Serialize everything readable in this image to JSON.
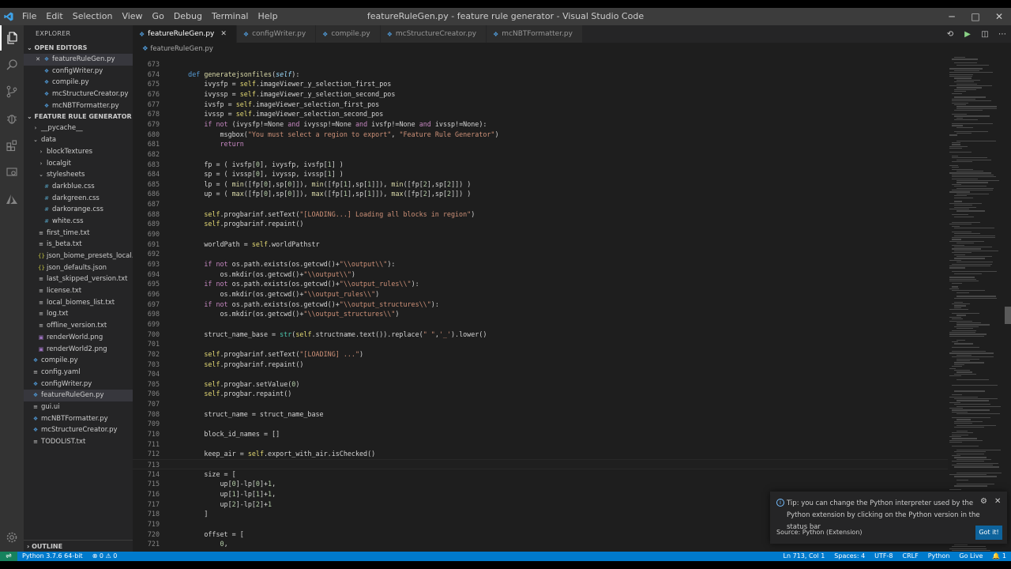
{
  "window": {
    "title": "featureRuleGen.py - feature rule generator - Visual Studio Code",
    "menu": [
      "File",
      "Edit",
      "Selection",
      "View",
      "Go",
      "Debug",
      "Terminal",
      "Help"
    ],
    "controls": {
      "minimize": "─",
      "maximize": "□",
      "close": "✕"
    }
  },
  "colors": {
    "accent": "#007acc",
    "sidebar_bg": "#252526",
    "editor_bg": "#1e1e1e",
    "python_icon": "#4e94ce"
  },
  "activity_bar": [
    "files-icon",
    "search-icon",
    "source-control-icon",
    "debug-icon",
    "extensions-icon",
    "remote-explorer-icon",
    "azure-icon",
    "settings-gear-icon"
  ],
  "sidebar": {
    "title": "EXPLORER",
    "open_editors_header": "OPEN EDITORS",
    "open_editors": [
      {
        "name": "featureRuleGen.py",
        "icon": "py",
        "selected": true,
        "closable": true
      },
      {
        "name": "configWriter.py",
        "icon": "py"
      },
      {
        "name": "compile.py",
        "icon": "py"
      },
      {
        "name": "mcStructureCreator.py",
        "icon": "py"
      },
      {
        "name": "mcNBTFormatter.py",
        "icon": "py"
      }
    ],
    "project_header": "FEATURE RULE GENERATOR",
    "tree": [
      {
        "name": "__pycache__",
        "type": "folder-collapsed",
        "depth": 1
      },
      {
        "name": "data",
        "type": "folder-open",
        "depth": 1
      },
      {
        "name": "blockTextures",
        "type": "folder-collapsed",
        "depth": 2
      },
      {
        "name": "localgit",
        "type": "folder-collapsed",
        "depth": 2
      },
      {
        "name": "stylesheets",
        "type": "folder-open",
        "depth": 2
      },
      {
        "name": "darkblue.css",
        "type": "css",
        "depth": 3
      },
      {
        "name": "darkgreen.css",
        "type": "css",
        "depth": 3
      },
      {
        "name": "darkorange.css",
        "type": "css",
        "depth": 3
      },
      {
        "name": "white.css",
        "type": "css",
        "depth": 3
      },
      {
        "name": "first_time.txt",
        "type": "txt",
        "depth": 2
      },
      {
        "name": "is_beta.txt",
        "type": "txt",
        "depth": 2
      },
      {
        "name": "json_biome_presets_local.j...",
        "type": "json",
        "depth": 2
      },
      {
        "name": "json_defaults.json",
        "type": "json",
        "depth": 2
      },
      {
        "name": "last_skipped_version.txt",
        "type": "txt",
        "depth": 2
      },
      {
        "name": "license.txt",
        "type": "txt",
        "depth": 2
      },
      {
        "name": "local_biomes_list.txt",
        "type": "txt",
        "depth": 2
      },
      {
        "name": "log.txt",
        "type": "txt",
        "depth": 2
      },
      {
        "name": "offline_version.txt",
        "type": "txt",
        "depth": 2
      },
      {
        "name": "renderWorld.png",
        "type": "png",
        "depth": 2
      },
      {
        "name": "renderWorld2.png",
        "type": "png",
        "depth": 2
      },
      {
        "name": "compile.py",
        "type": "py",
        "depth": 1
      },
      {
        "name": "config.yaml",
        "type": "txt",
        "depth": 1
      },
      {
        "name": "configWriter.py",
        "type": "py",
        "depth": 1
      },
      {
        "name": "featureRuleGen.py",
        "type": "py",
        "depth": 1,
        "selected": true
      },
      {
        "name": "gui.ui",
        "type": "txt",
        "depth": 1
      },
      {
        "name": "mcNBTFormatter.py",
        "type": "py",
        "depth": 1
      },
      {
        "name": "mcStructureCreator.py",
        "type": "py",
        "depth": 1
      },
      {
        "name": "TODOLIST.txt",
        "type": "txt",
        "depth": 1
      }
    ],
    "outline_header": "OUTLINE"
  },
  "tabs": [
    {
      "label": "featureRuleGen.py",
      "active": true
    },
    {
      "label": "configWriter.py"
    },
    {
      "label": "compile.py"
    },
    {
      "label": "mcStructureCreator.py"
    },
    {
      "label": "mcNBTFormatter.py"
    }
  ],
  "breadcrumb": "featureRuleGen.py",
  "editor": {
    "current_line": 713,
    "lines": [
      {
        "n": 673,
        "t": []
      },
      {
        "n": 674,
        "t": [
          [
            "",
            "    "
          ],
          [
            "def",
            "def "
          ],
          [
            "fn",
            "generatejsonfiles"
          ],
          [
            "op",
            "("
          ],
          [
            "param",
            "self"
          ],
          [
            "op",
            "):"
          ]
        ]
      },
      {
        "n": 675,
        "t": [
          [
            "",
            "        ivysfp = "
          ],
          [
            "self",
            "self"
          ],
          [
            "op",
            ".imageViewer_y_selection_first_pos"
          ]
        ]
      },
      {
        "n": 676,
        "t": [
          [
            "",
            "        ivyssp = "
          ],
          [
            "self",
            "self"
          ],
          [
            "op",
            ".imageViewer_y_selection_second_pos"
          ]
        ]
      },
      {
        "n": 677,
        "t": [
          [
            "",
            "        ivsfp = "
          ],
          [
            "self",
            "self"
          ],
          [
            "op",
            ".imageViewer_selection_first_pos"
          ]
        ]
      },
      {
        "n": 678,
        "t": [
          [
            "",
            "        ivssp = "
          ],
          [
            "self",
            "self"
          ],
          [
            "op",
            ".imageViewer_selection_second_pos"
          ]
        ]
      },
      {
        "n": 679,
        "t": [
          [
            "",
            "        "
          ],
          [
            "kw",
            "if not"
          ],
          [
            "op",
            " (ivysfp!=None "
          ],
          [
            "kw",
            "and"
          ],
          [
            "op",
            " ivyssp!=None "
          ],
          [
            "kw",
            "and"
          ],
          [
            "op",
            " ivsfp!=None "
          ],
          [
            "kw",
            "and"
          ],
          [
            "op",
            " ivssp!=None):"
          ]
        ]
      },
      {
        "n": 680,
        "t": [
          [
            "",
            "            msgbox("
          ],
          [
            "str",
            "\"You must select a region to export\""
          ],
          [
            "op",
            ", "
          ],
          [
            "str",
            "\"Feature Rule Generator\""
          ],
          [
            "op",
            ")"
          ]
        ]
      },
      {
        "n": 681,
        "t": [
          [
            "",
            "            "
          ],
          [
            "kw",
            "return"
          ]
        ]
      },
      {
        "n": 682,
        "t": []
      },
      {
        "n": 683,
        "t": [
          [
            "",
            "        fp = ( ivsfp["
          ],
          [
            "num",
            "0"
          ],
          [
            "op",
            "], ivysfp, ivsfp["
          ],
          [
            "num",
            "1"
          ],
          [
            "op",
            "] )"
          ]
        ]
      },
      {
        "n": 684,
        "t": [
          [
            "",
            "        sp = ( ivssp["
          ],
          [
            "num",
            "0"
          ],
          [
            "op",
            "], ivyssp, ivssp["
          ],
          [
            "num",
            "1"
          ],
          [
            "op",
            "] )"
          ]
        ]
      },
      {
        "n": 685,
        "t": [
          [
            "",
            "        lp = ( "
          ],
          [
            "fn",
            "min"
          ],
          [
            "op",
            "([fp["
          ],
          [
            "num",
            "0"
          ],
          [
            "op",
            "],sp["
          ],
          [
            "num",
            "0"
          ],
          [
            "op",
            "]]), "
          ],
          [
            "fn",
            "min"
          ],
          [
            "op",
            "([fp["
          ],
          [
            "num",
            "1"
          ],
          [
            "op",
            "],sp["
          ],
          [
            "num",
            "1"
          ],
          [
            "op",
            "]]), "
          ],
          [
            "fn",
            "min"
          ],
          [
            "op",
            "([fp["
          ],
          [
            "num",
            "2"
          ],
          [
            "op",
            "],sp["
          ],
          [
            "num",
            "2"
          ],
          [
            "op",
            "]]) )"
          ]
        ]
      },
      {
        "n": 686,
        "t": [
          [
            "",
            "        up = ( "
          ],
          [
            "fn",
            "max"
          ],
          [
            "op",
            "([fp["
          ],
          [
            "num",
            "0"
          ],
          [
            "op",
            "],sp["
          ],
          [
            "num",
            "0"
          ],
          [
            "op",
            "]]), "
          ],
          [
            "fn",
            "max"
          ],
          [
            "op",
            "([fp["
          ],
          [
            "num",
            "1"
          ],
          [
            "op",
            "],sp["
          ],
          [
            "num",
            "1"
          ],
          [
            "op",
            "]]), "
          ],
          [
            "fn",
            "max"
          ],
          [
            "op",
            "([fp["
          ],
          [
            "num",
            "2"
          ],
          [
            "op",
            "],sp["
          ],
          [
            "num",
            "2"
          ],
          [
            "op",
            "]]) )"
          ]
        ]
      },
      {
        "n": 687,
        "t": []
      },
      {
        "n": 688,
        "t": [
          [
            "",
            "        "
          ],
          [
            "self",
            "self"
          ],
          [
            "op",
            ".progbarinf.setText("
          ],
          [
            "str",
            "\"[LOADING...] Loading all blocks in region\""
          ],
          [
            "op",
            ")"
          ]
        ]
      },
      {
        "n": 689,
        "t": [
          [
            "",
            "        "
          ],
          [
            "self",
            "self"
          ],
          [
            "op",
            ".progbarinf.repaint()"
          ]
        ]
      },
      {
        "n": 690,
        "t": []
      },
      {
        "n": 691,
        "t": [
          [
            "",
            "        worldPath = "
          ],
          [
            "self",
            "self"
          ],
          [
            "op",
            ".worldPathstr"
          ]
        ]
      },
      {
        "n": 692,
        "t": []
      },
      {
        "n": 693,
        "t": [
          [
            "",
            "        "
          ],
          [
            "kw",
            "if not"
          ],
          [
            "op",
            " os.path.exists(os.getcwd()+"
          ],
          [
            "str",
            "\"\\\\output\\\\\""
          ],
          [
            "op",
            "):"
          ]
        ]
      },
      {
        "n": 694,
        "t": [
          [
            "",
            "            os.mkdir(os.getcwd()+"
          ],
          [
            "str",
            "\"\\\\output\\\\\""
          ],
          [
            "op",
            ")"
          ]
        ]
      },
      {
        "n": 695,
        "t": [
          [
            "",
            "        "
          ],
          [
            "kw",
            "if not"
          ],
          [
            "op",
            " os.path.exists(os.getcwd()+"
          ],
          [
            "str",
            "\"\\\\output_rules\\\\\""
          ],
          [
            "op",
            "):"
          ]
        ]
      },
      {
        "n": 696,
        "t": [
          [
            "",
            "            os.mkdir(os.getcwd()+"
          ],
          [
            "str",
            "\"\\\\output_rules\\\\\""
          ],
          [
            "op",
            ")"
          ]
        ]
      },
      {
        "n": 697,
        "t": [
          [
            "",
            "        "
          ],
          [
            "kw",
            "if not"
          ],
          [
            "op",
            " os.path.exists(os.getcwd()+"
          ],
          [
            "str",
            "\"\\\\output_structures\\\\\""
          ],
          [
            "op",
            "):"
          ]
        ]
      },
      {
        "n": 698,
        "t": [
          [
            "",
            "            os.mkdir(os.getcwd()+"
          ],
          [
            "str",
            "\"\\\\output_structures\\\\\""
          ],
          [
            "op",
            ")"
          ]
        ]
      },
      {
        "n": 699,
        "t": []
      },
      {
        "n": 700,
        "t": [
          [
            "",
            "        struct_name_base = "
          ],
          [
            "bi",
            "str"
          ],
          [
            "op",
            "("
          ],
          [
            "self",
            "self"
          ],
          [
            "op",
            ".structname.text()).replace("
          ],
          [
            "str",
            "\" \""
          ],
          [
            "op",
            ","
          ],
          [
            "str",
            "'_'"
          ],
          [
            "op",
            ").lower()"
          ]
        ]
      },
      {
        "n": 701,
        "t": []
      },
      {
        "n": 702,
        "t": [
          [
            "",
            "        "
          ],
          [
            "self",
            "self"
          ],
          [
            "op",
            ".progbarinf.setText("
          ],
          [
            "str",
            "\"[LOADING] ...\""
          ],
          [
            "op",
            ")"
          ]
        ]
      },
      {
        "n": 703,
        "t": [
          [
            "",
            "        "
          ],
          [
            "self",
            "self"
          ],
          [
            "op",
            ".progbarinf.repaint()"
          ]
        ]
      },
      {
        "n": 704,
        "t": []
      },
      {
        "n": 705,
        "t": [
          [
            "",
            "        "
          ],
          [
            "self",
            "self"
          ],
          [
            "op",
            ".progbar.setValue("
          ],
          [
            "num",
            "0"
          ],
          [
            "op",
            ")"
          ]
        ]
      },
      {
        "n": 706,
        "t": [
          [
            "",
            "        "
          ],
          [
            "self",
            "self"
          ],
          [
            "op",
            ".progbar.repaint()"
          ]
        ]
      },
      {
        "n": 707,
        "t": []
      },
      {
        "n": 708,
        "t": [
          [
            "",
            "        struct_name = struct_name_base"
          ]
        ]
      },
      {
        "n": 709,
        "t": []
      },
      {
        "n": 710,
        "t": [
          [
            "",
            "        block_id_names = []"
          ]
        ]
      },
      {
        "n": 711,
        "t": []
      },
      {
        "n": 712,
        "t": [
          [
            "",
            "        keep_air = "
          ],
          [
            "self",
            "self"
          ],
          [
            "op",
            ".export_with_air.isChecked()"
          ]
        ]
      },
      {
        "n": 713,
        "t": []
      },
      {
        "n": 714,
        "t": [
          [
            "",
            "        size = ["
          ]
        ]
      },
      {
        "n": 715,
        "t": [
          [
            "",
            "            up["
          ],
          [
            "num",
            "0"
          ],
          [
            "op",
            "]-lp["
          ],
          [
            "num",
            "0"
          ],
          [
            "op",
            "]+"
          ],
          [
            "num",
            "1"
          ],
          [
            "op",
            ","
          ]
        ]
      },
      {
        "n": 716,
        "t": [
          [
            "",
            "            up["
          ],
          [
            "num",
            "1"
          ],
          [
            "op",
            "]-lp["
          ],
          [
            "num",
            "1"
          ],
          [
            "op",
            "]+"
          ],
          [
            "num",
            "1"
          ],
          [
            "op",
            ","
          ]
        ]
      },
      {
        "n": 717,
        "t": [
          [
            "",
            "            up["
          ],
          [
            "num",
            "2"
          ],
          [
            "op",
            "]-lp["
          ],
          [
            "num",
            "2"
          ],
          [
            "op",
            "]+"
          ],
          [
            "num",
            "1"
          ]
        ]
      },
      {
        "n": 718,
        "t": [
          [
            "",
            "        ]"
          ]
        ]
      },
      {
        "n": 719,
        "t": []
      },
      {
        "n": 720,
        "t": [
          [
            "",
            "        offset = ["
          ]
        ]
      },
      {
        "n": 721,
        "t": [
          [
            "",
            "            "
          ],
          [
            "num",
            "0"
          ],
          [
            "op",
            ","
          ]
        ]
      }
    ]
  },
  "notification": {
    "message": "Tip: you can change the Python interpreter used by the Python extension by clicking on the Python version in the status bar",
    "source": "Source: Python (Extension)",
    "button": "Got it!"
  },
  "statusbar": {
    "interpreter": "Python 3.7.6 64-bit",
    "problems": "⊗ 0 ⚠ 0",
    "position": "Ln 713, Col 1",
    "spaces": "Spaces: 4",
    "encoding": "UTF-8",
    "eol": "CRLF",
    "language": "Python",
    "golive": "Go Live",
    "bell": "🔔 1"
  }
}
